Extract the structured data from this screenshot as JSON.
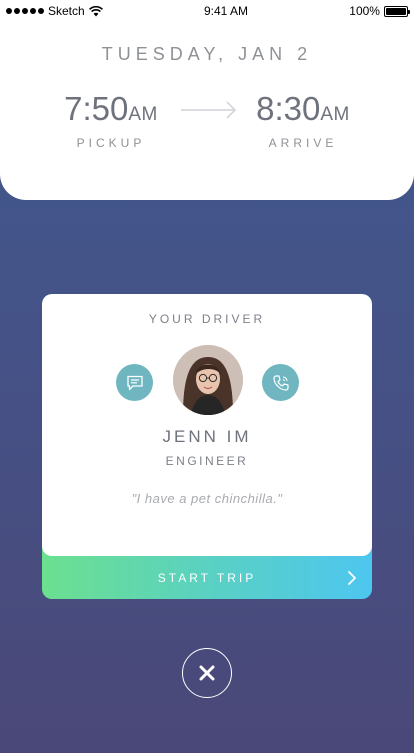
{
  "status_bar": {
    "carrier": "Sketch",
    "time": "9:41 AM",
    "battery": "100%",
    "icons": [
      "signal-dots-icon",
      "wifi-icon",
      "battery-icon"
    ]
  },
  "trip": {
    "date": "TUESDAY, JAN 2",
    "pickup": {
      "time": "7:50",
      "ampm": "AM",
      "label": "PICKUP"
    },
    "arrive": {
      "time": "8:30",
      "ampm": "AM",
      "label": "ARRIVE"
    },
    "arrow_icon": "arrow-right-icon"
  },
  "driver": {
    "heading": "YOUR DRIVER",
    "name": "JENN IM",
    "title": "ENGINEER",
    "quote": "\"I have a pet chinchilla.\"",
    "message_icon": "chat-bubble-icon",
    "call_icon": "phone-icon"
  },
  "actions": {
    "start_trip": "START TRIP",
    "start_icon": "chevron-right-icon",
    "close_icon": "close-icon"
  },
  "colors": {
    "background_top": "#3f5a8f",
    "background_bottom": "#4a4878",
    "accent_teal": "#6fb6c1",
    "gradient_start": "#6ce08e",
    "gradient_end": "#4dc6f0"
  }
}
